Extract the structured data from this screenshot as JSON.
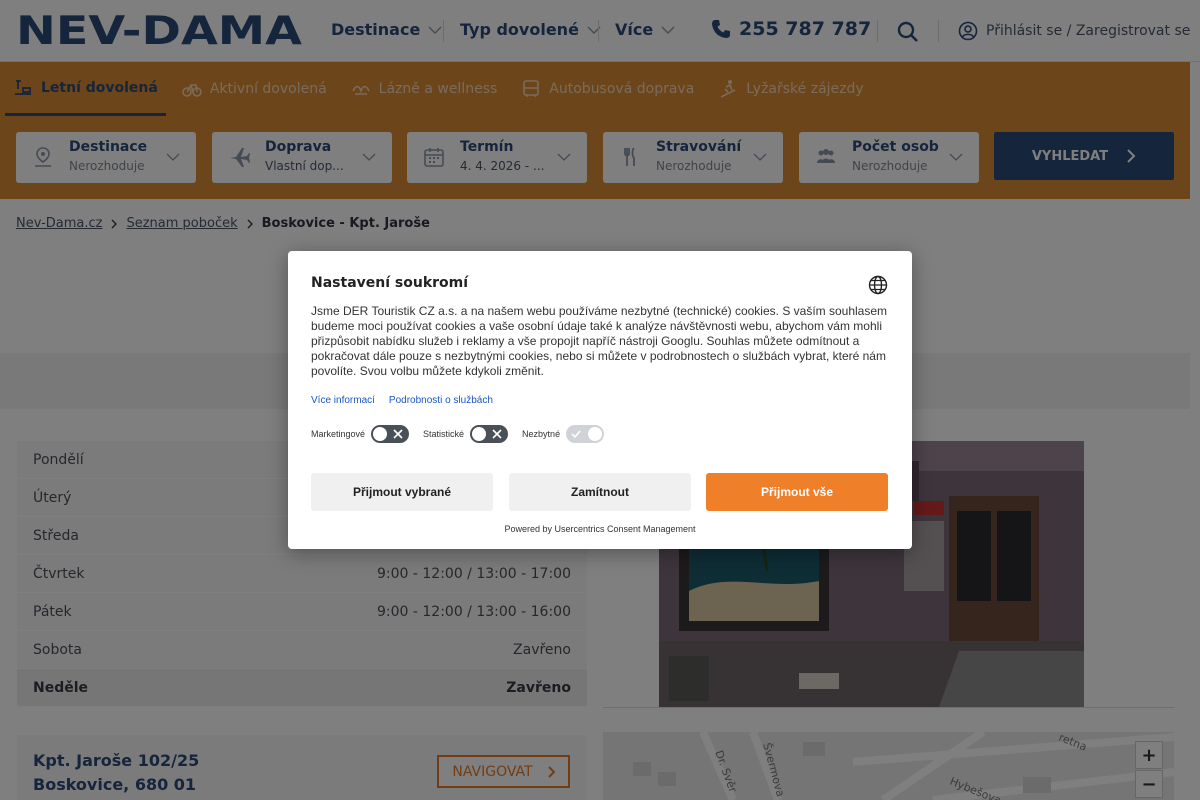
{
  "header": {
    "logo_text": "NEV-DAMA",
    "nav": [
      "Destinace",
      "Typ dovolené",
      "Více"
    ],
    "phone": "255 787 787",
    "login": "Přihlásit se / Zaregistrovat se"
  },
  "tabs": [
    "Letní dovolená",
    "Aktivní dovolená",
    "Lázně a wellness",
    "Autobusová doprava",
    "Lyžařské zájezdy"
  ],
  "search": {
    "fields": [
      {
        "label": "Destinace",
        "value": "Nerozhoduje",
        "icon": "map-pin-icon"
      },
      {
        "label": "Doprava",
        "value": "Vlastní dop...",
        "icon": "airplane-icon"
      },
      {
        "label": "Termín",
        "value": "4. 4. 2026 - ...",
        "icon": "calendar-icon"
      },
      {
        "label": "Stravování",
        "value": "Nerozhoduje",
        "icon": "cutlery-icon"
      },
      {
        "label": "Počet osob",
        "value": "Nerozhoduje",
        "icon": "people-icon"
      }
    ],
    "button": "VYHLEDAT"
  },
  "breadcrumb": [
    "Nev-Dama.cz",
    "Seznam poboček",
    "Boskovice - Kpt. Jaroše"
  ],
  "hours": [
    {
      "day": "Pondělí",
      "time": ""
    },
    {
      "day": "Úterý",
      "time": ""
    },
    {
      "day": "Středa",
      "time": ""
    },
    {
      "day": "Čtvrtek",
      "time": "9:00 - 12:00 / 13:00 - 17:00"
    },
    {
      "day": "Pátek",
      "time": "9:00 - 12:00 / 13:00 - 16:00"
    },
    {
      "day": "Sobota",
      "time": "Zavřeno"
    },
    {
      "day": "Neděle",
      "time": "Zavřeno"
    }
  ],
  "address": {
    "line1": "Kpt. Jaroše 102/25",
    "line2": "Boskovice, 680 01",
    "navigate": "NAVIGOVAT"
  },
  "map": {
    "streets": [
      "Dr. Svěr",
      "Švermova",
      "Hybešova",
      "retna"
    ],
    "zoom_in": "+",
    "zoom_out": "−"
  },
  "consent": {
    "title": "Nastavení soukromí",
    "text": "Jsme DER Touristik CZ a.s. a na našem webu používáme nezbytné (technické) cookies. S vaším souhlasem budeme moci používat cookies a vaše osobní údaje také k analýze návštěvnosti webu, abychom vám mohli přizpůsobit nabídku služeb i reklamy a vše propojit napříč nástroji Googlu. Souhlas můžete odmítnout a pokračovat dále pouze s nezbytnými cookies, nebo si můžete v podrobnostech o službách vybrat, které nám povolíte. Svou volbu můžete kdykoli změnit.",
    "link_more": "Více informací",
    "link_details": "Podrobnosti o službách",
    "toggles": [
      {
        "label": "Marketingové",
        "on": false
      },
      {
        "label": "Statistické",
        "on": false
      },
      {
        "label": "Nezbytné",
        "on": true
      }
    ],
    "btn_selected": "Přijmout vybrané",
    "btn_reject": "Zamítnout",
    "btn_accept": "Přijmout vše",
    "powered": "Powered by Usercentrics Consent Management"
  },
  "colors": {
    "brand": "#2b4a79",
    "orange": "#db8a36",
    "accent": "#f07f2a"
  }
}
